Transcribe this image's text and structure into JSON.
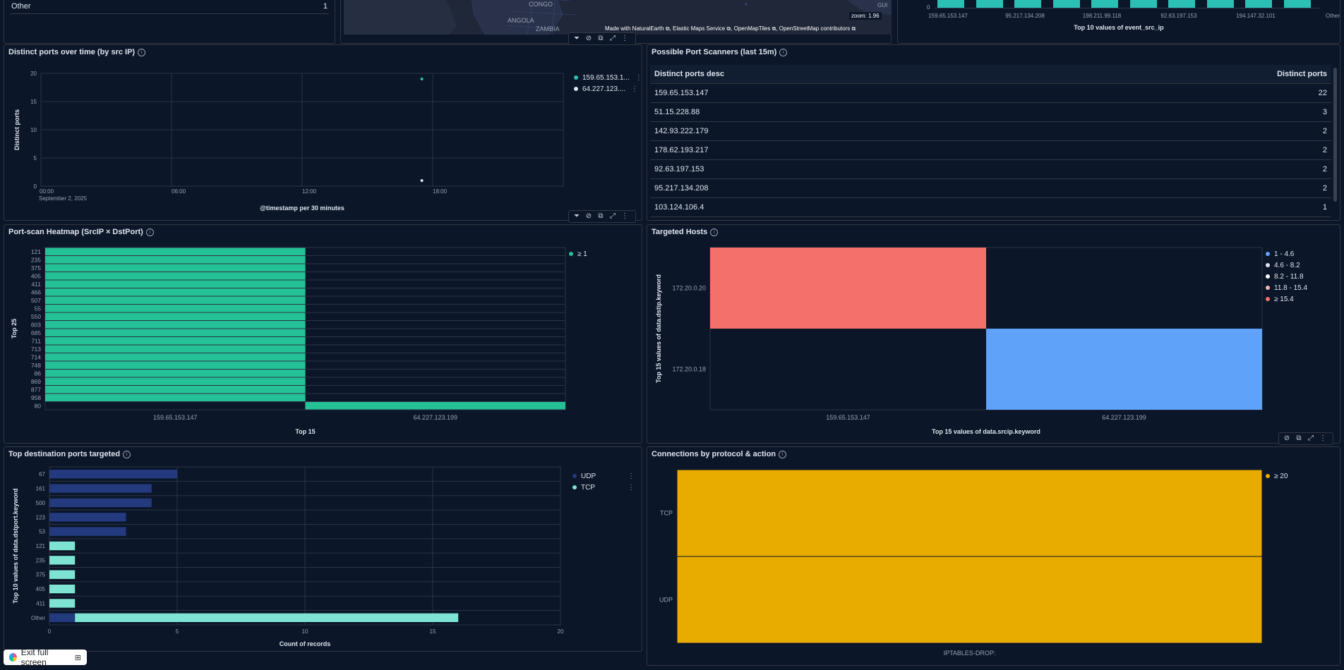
{
  "colors": {
    "teal": "#2cbfb4",
    "green": "#25c196",
    "udp": "#233a7e",
    "tcp": "#7ee3d2",
    "salmon": "#f4706a",
    "blue": "#5fa2fa",
    "gold": "#e8ac00"
  },
  "top_strip": {
    "other_label": "Other",
    "other_value": "1",
    "map_labels": [
      "CONGO",
      "ANGOLA",
      "ZAMBIA",
      "GUI"
    ],
    "zoom": "zoom: 1.96",
    "attribution": [
      "Made with NaturalEarth",
      "Elastic Maps Service",
      "OpenMapTiles",
      "OpenStreetMap contributors"
    ],
    "bar_zero_tick": "0",
    "bar_ticks": [
      "159.65.153.147",
      "95.217.134.208",
      "198.211.99.118",
      "92.63.197.153",
      "194.147.32.101",
      "Other"
    ],
    "bar_axis_title": "Top 10 values of event_src_ip"
  },
  "panel_ports_over_time": {
    "title": "Distinct ports over time (by src IP)",
    "chart_data": {
      "type": "scatter",
      "ylabel": "Distinct ports",
      "xlabel": "@timestamp per 30 minutes",
      "ylim": [
        0,
        20
      ],
      "y_ticks": [
        "20",
        "15",
        "10",
        "5",
        "0"
      ],
      "x_ticks": [
        "00:00",
        "06:00",
        "12:00",
        "18:00"
      ],
      "x_subtitle": "September 2, 2025",
      "series": [
        {
          "name": "159.65.153.1...",
          "color": "#2cbfb4",
          "points": [
            {
              "x": "17:30",
              "y": 19
            }
          ]
        },
        {
          "name": "64.227.123....",
          "color": "#dfe5ef",
          "points": [
            {
              "x": "17:30",
              "y": 1
            }
          ]
        }
      ]
    }
  },
  "panel_scanners": {
    "title": "Possible Port Scanners (last 15m)",
    "columns": [
      "Distinct ports desc",
      "Distinct ports"
    ],
    "rows": [
      [
        "159.65.153.147",
        "22"
      ],
      [
        "51.15.228.88",
        "3"
      ],
      [
        "142.93.222.179",
        "2"
      ],
      [
        "178.62.193.217",
        "2"
      ],
      [
        "92.63.197.153",
        "2"
      ],
      [
        "95.217.134.208",
        "2"
      ],
      [
        "103.124.106.4",
        "1"
      ]
    ]
  },
  "panel_heatmap": {
    "title": "Port-scan Heatmap (SrcIP × DstPort)",
    "chart_data": {
      "type": "heatmap",
      "ylabel": "Top 25",
      "xlabel": "Top 15",
      "y_categories": [
        "121",
        "235",
        "375",
        "405",
        "411",
        "466",
        "507",
        "55",
        "550",
        "603",
        "685",
        "711",
        "713",
        "714",
        "748",
        "86",
        "869",
        "877",
        "958",
        "80"
      ],
      "x_categories": [
        "159.65.153.147",
        "64.227.123.199"
      ],
      "filled": {
        "159.65.153.147": [
          "121",
          "235",
          "375",
          "405",
          "411",
          "466",
          "507",
          "55",
          "550",
          "603",
          "685",
          "711",
          "713",
          "714",
          "748",
          "86",
          "869",
          "877",
          "958"
        ],
        "64.227.123.199": [
          "80"
        ]
      },
      "legend": [
        "≥ 1"
      ]
    }
  },
  "panel_targeted": {
    "title": "Targeted Hosts",
    "chart_data": {
      "type": "heatmap",
      "ylabel": "Top 15 values of data.dstip.keyword",
      "xlabel": "Top 15 values of data.srcip.keyword",
      "y_categories": [
        "172.20.0.20",
        "172.20.0.18"
      ],
      "x_categories": [
        "159.65.153.147",
        "64.227.123.199"
      ],
      "cells": [
        {
          "x": "159.65.153.147",
          "y": "172.20.0.20",
          "bucket": "≥ 15.4"
        },
        {
          "x": "64.227.123.199",
          "y": "172.20.0.18",
          "bucket": "1 - 4.6"
        }
      ],
      "legend": [
        {
          "label": "1 - 4.6",
          "color": "#5fa2fa"
        },
        {
          "label": "4.6 - 8.2",
          "color": "#dfe5ef"
        },
        {
          "label": "8.2 - 11.8",
          "color": "#ffffff"
        },
        {
          "label": "11.8 - 15.4",
          "color": "#f5b8b0"
        },
        {
          "label": "≥ 15.4",
          "color": "#f4706a"
        }
      ]
    }
  },
  "panel_dstports": {
    "title": "Top destination ports targeted",
    "chart_data": {
      "type": "bar",
      "orientation": "horizontal",
      "ylabel": "Top 10 values of data.dstport.keyword",
      "xlabel": "Count of records",
      "xlim": [
        0,
        20
      ],
      "x_ticks": [
        "0",
        "5",
        "10",
        "15",
        "20"
      ],
      "categories": [
        "67",
        "161",
        "500",
        "123",
        "53",
        "121",
        "235",
        "375",
        "405",
        "411",
        "Other"
      ],
      "series": [
        {
          "name": "UDP",
          "color": "#233a7e",
          "values": [
            5,
            4,
            4,
            3,
            3,
            0,
            0,
            0,
            0,
            0,
            1
          ]
        },
        {
          "name": "TCP",
          "color": "#7ee3d2",
          "values": [
            0,
            0,
            0,
            0,
            0,
            1,
            1,
            1,
            1,
            1,
            15
          ]
        }
      ]
    }
  },
  "panel_protocol": {
    "title": "Connections by protocol & action",
    "chart_data": {
      "type": "heatmap",
      "y_categories": [
        "TCP",
        "UDP"
      ],
      "x_categories": [
        "IPTABLES-DROP:"
      ],
      "legend": [
        "≥ 20"
      ]
    }
  },
  "exit_full_screen": "Exit full screen"
}
